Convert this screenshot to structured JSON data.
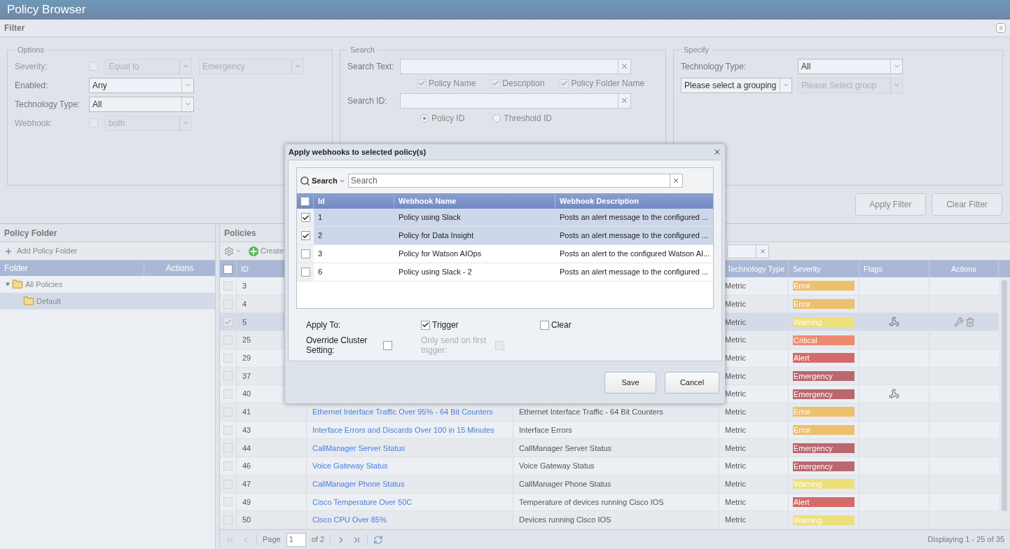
{
  "window": {
    "title": "Policy Browser"
  },
  "filter": {
    "title": "Filter",
    "options": {
      "legend": "Options",
      "fields": [
        {
          "label": "Severity:",
          "disabled": true,
          "checkbox": {
            "checked": false
          },
          "combos": [
            {
              "value": "Equal to",
              "disabled": true
            },
            {
              "value": "Emergency",
              "disabled": true
            }
          ]
        },
        {
          "label": "Enabled:",
          "disabled": false,
          "combos": [
            {
              "value": "Any",
              "disabled": false
            }
          ]
        },
        {
          "label": "Technology Type:",
          "disabled": false,
          "combos": [
            {
              "value": "All",
              "disabled": false
            }
          ]
        },
        {
          "label": "Webhook:",
          "disabled": true,
          "checkbox": {
            "checked": false
          },
          "combos": [
            {
              "value": "both",
              "disabled": true
            }
          ]
        }
      ]
    },
    "search": {
      "legend": "Search",
      "text_label": "Search Text:",
      "checks": [
        {
          "label": "Policy Name",
          "checked": true
        },
        {
          "label": "Description",
          "checked": true
        },
        {
          "label": "Policy Folder Name",
          "checked": true
        }
      ],
      "id_label": "Search ID:",
      "radios": [
        {
          "label": "Policy ID",
          "selected": true
        },
        {
          "label": "Threshold ID",
          "selected": false
        }
      ]
    },
    "specify": {
      "legend": "Specify",
      "tech_label": "Technology Type:",
      "tech_value": "All",
      "grouping": {
        "value": "Please select a grouping",
        "disabled": false
      },
      "group": {
        "value": "Please Select group",
        "disabled": true
      }
    },
    "buttons": [
      "Apply Filter",
      "Clear Filter"
    ]
  },
  "folders": {
    "title": "Policy Folder",
    "add_label": "Add Policy Folder",
    "columns": [
      "Folder",
      "Actions"
    ],
    "tree": [
      {
        "label": "All Policies",
        "expanded": true,
        "selected": false,
        "children": [
          {
            "label": "Default",
            "selected": true
          }
        ]
      }
    ]
  },
  "policies": {
    "title": "Policies",
    "create_label": "Create",
    "select_all": false,
    "columns": [
      {
        "kind": "id",
        "label": "ID"
      },
      {
        "kind": "tech",
        "label": "Technology Type"
      },
      {
        "kind": "severity",
        "label": "Severity"
      },
      {
        "kind": "flags",
        "label": "Flags"
      },
      {
        "kind": "actions",
        "label": "Actions"
      }
    ],
    "rows": [
      {
        "id": "3",
        "tech": "Metric",
        "severity": "Error",
        "color": "#edc06e",
        "selected": false,
        "webhook": false,
        "actions": false
      },
      {
        "id": "4",
        "tech": "Metric",
        "severity": "Error",
        "color": "#edc06e",
        "selected": false,
        "webhook": false,
        "actions": false
      },
      {
        "id": "5",
        "tech": "Metric",
        "severity": "Warning",
        "color": "#ede07a",
        "selected": true,
        "webhook": true,
        "actions": true
      },
      {
        "id": "25",
        "tech": "Metric",
        "severity": "Critical",
        "color": "#ef8a72",
        "selected": false,
        "webhook": false,
        "actions": false
      },
      {
        "id": "29",
        "tech": "Metric",
        "severity": "Alert",
        "color": "#d46b6b",
        "selected": false,
        "webhook": false,
        "actions": false
      },
      {
        "id": "37",
        "tech": "Metric",
        "severity": "Emergency",
        "color": "#b9686e",
        "selected": false,
        "webhook": false,
        "actions": false
      },
      {
        "id": "40",
        "tech": "Metric",
        "severity": "Emergency",
        "color": "#b9686e",
        "selected": false,
        "webhook": true,
        "actions": false
      },
      {
        "id": "41",
        "name": "Ethernet Interface Traffic Over 95% - 64 Bit Counters",
        "description": "Ethernet Interface Traffic - 64 Bit Counters",
        "tech": "Metric",
        "severity": "Error",
        "color": "#edc06e",
        "selected": false,
        "webhook": false,
        "actions": false
      },
      {
        "id": "43",
        "name": "Interface Errors and Discards Over 100 in 15 Minutes",
        "description": "Interface Errors",
        "tech": "Metric",
        "severity": "Error",
        "color": "#edc06e",
        "selected": false,
        "webhook": false,
        "actions": false
      },
      {
        "id": "44",
        "name": "CallManager Server Status",
        "description": "CallManager Server Status",
        "tech": "Metric",
        "severity": "Emergency",
        "color": "#b9686e",
        "selected": false,
        "webhook": false,
        "actions": false
      },
      {
        "id": "46",
        "name": "Voice Gateway Status",
        "description": "Voice Gateway Status",
        "tech": "Metric",
        "severity": "Emergency",
        "color": "#b9686e",
        "selected": false,
        "webhook": false,
        "actions": false
      },
      {
        "id": "47",
        "name": "CallManager Phone Status",
        "description": "CallManager Phone Status",
        "tech": "Metric",
        "severity": "Warning",
        "color": "#ede07a",
        "selected": false,
        "webhook": false,
        "actions": false
      },
      {
        "id": "49",
        "name": "Cisco Temperature Over 50C",
        "description": "Temperature of devices running Cisco IOS",
        "tech": "Metric",
        "severity": "Alert",
        "color": "#d46b6b",
        "selected": false,
        "webhook": false,
        "actions": false
      },
      {
        "id": "50",
        "name": "Cisco CPU Over 85%",
        "description": "Devices running Cisco IOS",
        "tech": "Metric",
        "severity": "Warning",
        "color": "#ede07a",
        "selected": false,
        "webhook": false,
        "actions": false
      }
    ],
    "pager": {
      "page_label": "Page",
      "page": "1",
      "of": "of 2",
      "display": "Displaying 1 - 25 of 35"
    }
  },
  "dialog": {
    "title": "Apply webhooks to selected policy(s)",
    "select_all": false,
    "search_menu": "Search",
    "search_placeholder": "Search",
    "columns": [
      "Id",
      "Webhook Name",
      "Webhook Description"
    ],
    "rows": [
      {
        "id": "1",
        "name": "Policy using Slack",
        "description": "Posts an alert message to the configured ...",
        "checked": true
      },
      {
        "id": "2",
        "name": "Policy for Data Insight",
        "description": "Posts an alert message to the configured ...",
        "checked": true
      },
      {
        "id": "3",
        "name": "Policy for Watson AIOps",
        "description": "Posts an alert to the configured Watson AI...",
        "checked": false
      },
      {
        "id": "6",
        "name": "Policy using Slack - 2",
        "description": "Posts an alert message to the configured ...",
        "checked": false
      }
    ],
    "apply_label": "Apply To:",
    "trigger": {
      "label": "Trigger",
      "checked": true
    },
    "clear": {
      "label": "Clear",
      "checked": false
    },
    "override": {
      "label": "Override Cluster Setting:",
      "checked": false
    },
    "first": {
      "label": "Only send on first trigger:",
      "checked": false,
      "disabled": true
    },
    "buttons": [
      "Save",
      "Cancel"
    ]
  }
}
